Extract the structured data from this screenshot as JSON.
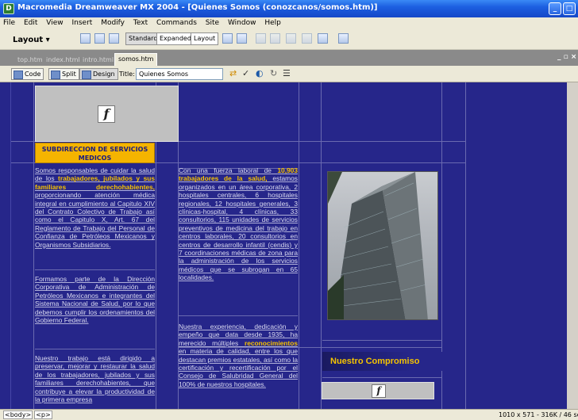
{
  "window": {
    "title": "Macromedia Dreamweaver MX 2004 - [Quienes Somos (conozcanos/somos.htm)]"
  },
  "menu": [
    "File",
    "Edit",
    "View",
    "Insert",
    "Modify",
    "Text",
    "Commands",
    "Site",
    "Window",
    "Help"
  ],
  "insert_bar": {
    "category": "Layout",
    "buttons": [
      "Standard",
      "Expanded",
      "Layout"
    ]
  },
  "tabs": [
    "top.htm",
    "index.html",
    "intro.html",
    "somos.htm"
  ],
  "active_tab": "somos.htm",
  "doc_toolbar": {
    "views": [
      "Code",
      "Split",
      "Design"
    ],
    "title_label": "Title:",
    "title_value": "Quienes Somos"
  },
  "page": {
    "section_heading": "SUBDIRECCION DE SERVICIOS MEDICOS",
    "col1": {
      "p1_a": "Somos responsables de cuidar la salud de los",
      "p1_hl": "trabajadores, jubilados y sus familiares derechohabientes,",
      "p1_b": "proporcionando atención médica integral en cumplimiento al Capitulo XIV del Contrato Colectivo de Trabajo así como el Capitulo X, Art. 67 del Reglamento de Trabajo del Personal de Confianza de Petróleos Mexicanos y Organismos Subsidiarios.",
      "p2": "Formamos parte de la Dirección Corporativa de Administración de Petróleos Mexicanos e integrantes del Sistema Nacional de Salud, por lo que debemos cumplir los ordenamientos del Gobierno Federal.",
      "p3": "Nuestro trabajo está dirigido a preservar, mejorar y restaurar la salud de los trabajadores, jubilados y sus familiares derechohabientes, que contribuye a elevar la productividad de la primera empresa"
    },
    "col2": {
      "p1_a": "Con una fuerza laboral de",
      "p1_hl": "10,903 trabajadores de la salud,",
      "p1_b": "estamos organizados en un área corporativa, 2 hospitales centrales, 6 hospitales regionales, 12 hospitales generales, 3 clínicas-hospital, 4 clínicas, 33 consultorios, 115 unidades de servicios preventivos de medicina del trabajo en centros laborales, 20 consultorios en centros de desarrollo infantil (cendis) y 7 coordinaciones médicas de zona para la administración de los servicios médicos que se subrogan en 65 localidades.",
      "p2_a": "Nuestra experiencia, dedicación y empeño que data desde 1935, ha merecido múltiples",
      "p2_hl": "reconocimientos",
      "p2_b": "en materia de calidad, entre los que destacan premios estatales, así como la certificación y recertificación por el Consejo de Salubridad General del 100% de nuestros hospitales."
    },
    "compromiso": "Nuestro Compromiso",
    "flash_glyph": "f"
  },
  "status": {
    "tags": [
      "<body>",
      "<p>"
    ],
    "info": "1010 x 571 - 316K / 46 sec"
  },
  "colors": {
    "canvas_bg": "#26268a",
    "accent_yellow": "#f5b400",
    "titlebar_blue": "#1c5fe0"
  }
}
